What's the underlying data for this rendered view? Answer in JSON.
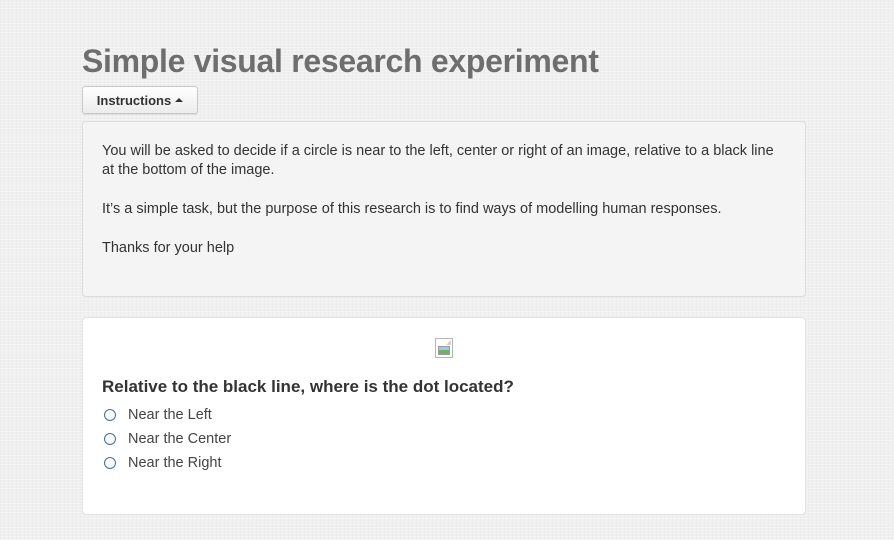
{
  "page": {
    "title": "Simple visual research experiment"
  },
  "instructions": {
    "button_label": "Instructions",
    "paragraphs": [
      "You will be asked to decide if a circle is near to the left, center or right of an image, relative to a black line at the bottom of the image.",
      "It’s a simple task, but the purpose of this research is to find ways of modelling human responses.",
      "Thanks for your help"
    ]
  },
  "question": {
    "text": "Relative to the black line, where is the dot located?",
    "options": [
      {
        "label": "Near the Left",
        "selected": false
      },
      {
        "label": "Near the Center",
        "selected": false
      },
      {
        "label": "Near the Right",
        "selected": false
      }
    ]
  },
  "colors": {
    "title": "#6e6e6e",
    "radio_border": "#4a6f9a",
    "background": "#efefef"
  }
}
